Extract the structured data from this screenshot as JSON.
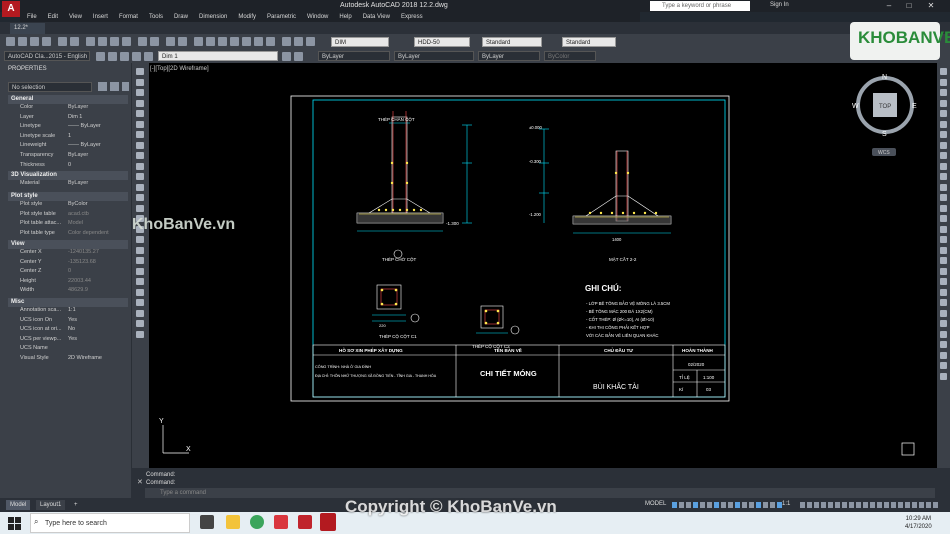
{
  "titlebar": {
    "app_name": "A",
    "title": "Autodesk AutoCAD 2018    12.2.dwg",
    "search_placeholder": "Type a keyword or phrase",
    "sign_in": "Sign In"
  },
  "menu": [
    "File",
    "Edit",
    "View",
    "Insert",
    "Format",
    "Tools",
    "Draw",
    "Dimension",
    "Modify",
    "Parametric",
    "Window",
    "Help",
    "Data View",
    "Express"
  ],
  "tabs": {
    "drawing": "12.2*"
  },
  "toolbar": {
    "dimstyle": "DIM",
    "textstyle": "HDD-50",
    "tablestyle": "Standard",
    "mleaderstyle": "Standard",
    "workspace": "AutoCAD Cla...2015 - English",
    "layer": "Dim 1",
    "color": "ByLayer",
    "linetype": "ByLayer",
    "lineweight": "ByLayer",
    "plotstyle": "ByColor"
  },
  "palette": {
    "title": "PROPERTIES",
    "selection": "No selection",
    "sections": {
      "general": "General",
      "viz3d": "3D Visualization",
      "plot": "Plot style",
      "view": "View",
      "misc": "Misc"
    },
    "general": [
      {
        "k": "Color",
        "v": "ByLayer"
      },
      {
        "k": "Layer",
        "v": "Dim 1"
      },
      {
        "k": "Linetype",
        "v": "—— ByLayer"
      },
      {
        "k": "Linetype scale",
        "v": "1"
      },
      {
        "k": "Lineweight",
        "v": "—— ByLayer"
      },
      {
        "k": "Transparency",
        "v": "ByLayer"
      },
      {
        "k": "Thickness",
        "v": "0"
      }
    ],
    "viz3d": [
      {
        "k": "Material",
        "v": "ByLayer"
      }
    ],
    "plot": [
      {
        "k": "Plot style",
        "v": "ByColor"
      },
      {
        "k": "Plot style table",
        "v": "acad.ctb"
      },
      {
        "k": "Plot table attac...",
        "v": "Model"
      },
      {
        "k": "Plot table type",
        "v": "Color dependent"
      }
    ],
    "view": [
      {
        "k": "Center X",
        "v": "-1240135.27"
      },
      {
        "k": "Center Y",
        "v": "-135123.68"
      },
      {
        "k": "Center Z",
        "v": "0"
      },
      {
        "k": "Height",
        "v": "22003.44"
      },
      {
        "k": "Width",
        "v": "48629.9"
      }
    ],
    "misc": [
      {
        "k": "Annotation sca...",
        "v": "1:1"
      },
      {
        "k": "UCS icon On",
        "v": "Yes"
      },
      {
        "k": "UCS icon at ori...",
        "v": "No"
      },
      {
        "k": "UCS per viewp...",
        "v": "Yes"
      },
      {
        "k": "UCS Name",
        "v": ""
      },
      {
        "k": "Visual Style",
        "v": "2D Wireframe"
      }
    ]
  },
  "viewport": {
    "label": "[-][Top][2D Wireframe]",
    "viewcube_top": "TOP",
    "compass_n": "N",
    "compass_s": "S",
    "compass_e": "E",
    "compass_w": "W",
    "wcs": "WCS",
    "ucs_y": "Y",
    "ucs_x": "X"
  },
  "drawing": {
    "title_top_left": "THÉP CHÂN CỘT",
    "label_section": "MẶT CẮT 2-2",
    "label_foot_steel": "THÉP CHỜ CỘT",
    "label_col1": "THÉP CỘ CỘT C1",
    "label_col2": "THÉP CỘ CỘT C2",
    "notes_title": "GHI CHÚ:",
    "notes": [
      "- LỚP BÊ TÔNG BẢO VỆ MÓNG LÀ 3.5CM",
      "- BÊ TÔNG MÁC 200 ĐÁ 1X2(CM)",
      "- CỐT THÉP: Ø (Ø<=10), AI (Ø>10)",
      "- KHI THI CÔNG PHẢI KẾT HỢP",
      "VỚI CÁC BẢN VẼ LIÊN QUAN KHÁC"
    ],
    "tb_h1": "HỒ SƠ XIN PHÉP XÂY DỰNG",
    "tb_h2": "TÊN BẢN VẼ",
    "tb_h3": "CHỦ ĐẦU TƯ",
    "tb_h4": "HOÀN THÀNH",
    "tb_project": "CÔNG TRÌNH: NHÀ Ở GIA ĐÌNH",
    "tb_address": "ĐỊA CHỈ: THÔN NHỮ THƯỢNG XÃ ĐỒNG TIẾN - TĨNH GIA - THANH HÓA",
    "tb_name": "CHI TIẾT MÓNG",
    "tb_owner": "BÙI KHẮC TÀI",
    "tb_date": "02/2020",
    "tb_scale_k": "TỈ LỆ",
    "tb_scale_v": "1:100",
    "tb_sheet_k": "KÍ",
    "tb_sheet_v": "03",
    "dims": [
      "±0.000",
      "-0.300",
      "-1.200",
      "-0.600",
      "-1.300",
      "1400",
      "150",
      "1150",
      "220"
    ]
  },
  "command": {
    "line1": "Command:",
    "line2": "Command:",
    "placeholder": "Type a command"
  },
  "status": {
    "model_tab": "Model",
    "layout_tab": "Layout1",
    "add": "+",
    "model_btn": "MODEL",
    "scale": "1:1"
  },
  "taskbar": {
    "search": "Type here to search",
    "time": "10:29 AM",
    "date": "4/17/2020"
  },
  "watermarks": {
    "brand": "KHOBANVE",
    "left": "KhoBanVe.vn",
    "bottom": "Copyright © KhoBanVe.vn"
  }
}
